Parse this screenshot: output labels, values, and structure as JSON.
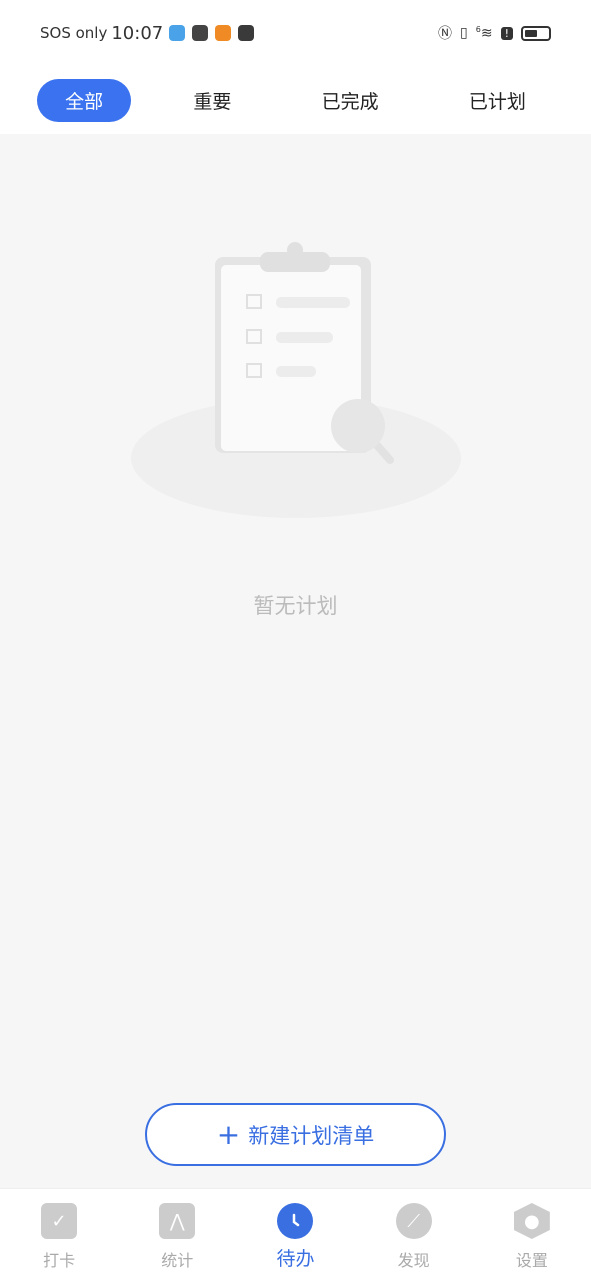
{
  "status_bar": {
    "carrier": "SOS only",
    "time": "10:07",
    "app_icon_colors": [
      "#4aa3e8",
      "#444444",
      "#f08a24",
      "#3a3a3a"
    ],
    "icons": [
      "nfc-icon",
      "vibrate-icon",
      "wifi-icon",
      "alert-icon",
      "battery-icon"
    ],
    "wifi_label": "6"
  },
  "tabs": [
    {
      "label": "全部",
      "active": true
    },
    {
      "label": "重要"
    },
    {
      "label": "已完成"
    },
    {
      "label": "已计划"
    }
  ],
  "empty_state": {
    "text": "暂无计划",
    "icon": "clipboard-search-icon"
  },
  "new_button": {
    "label": "新建计划清单",
    "icon": "plus-icon"
  },
  "nav": [
    {
      "label": "打卡",
      "icon": "check-icon"
    },
    {
      "label": "统计",
      "icon": "chart-icon"
    },
    {
      "label": "待办",
      "icon": "clock-icon",
      "active": true
    },
    {
      "label": "发现",
      "icon": "compass-icon"
    },
    {
      "label": "设置",
      "icon": "settings-icon"
    }
  ],
  "colors": {
    "accent": "#3a72ef",
    "inactive": "#cccccc"
  }
}
